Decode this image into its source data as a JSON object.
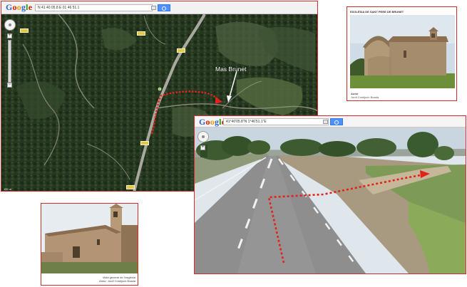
{
  "map": {
    "logo": "Google",
    "search_value": "N 41 40 05.8 E 01 46 51.1",
    "place_label": "Mas Brunet",
    "scale_text": "100 m",
    "route_color": "#e3231b"
  },
  "church": {
    "title": "ESGLÉSIA DE SANT PERE DE BRUNET",
    "caption_label": "Autor",
    "caption_author": "Jordi Contijoch Boada"
  },
  "street": {
    "logo": "Google",
    "search_value": "41°40'05.8\"N 1°46'51.1\"E",
    "route_color": "#e3231b"
  },
  "photo2": {
    "caption_line1": "Vista general de l'església",
    "caption_line2": "Autor: Jordi Contijoch Boada"
  },
  "frame_color": "#d42b2b"
}
